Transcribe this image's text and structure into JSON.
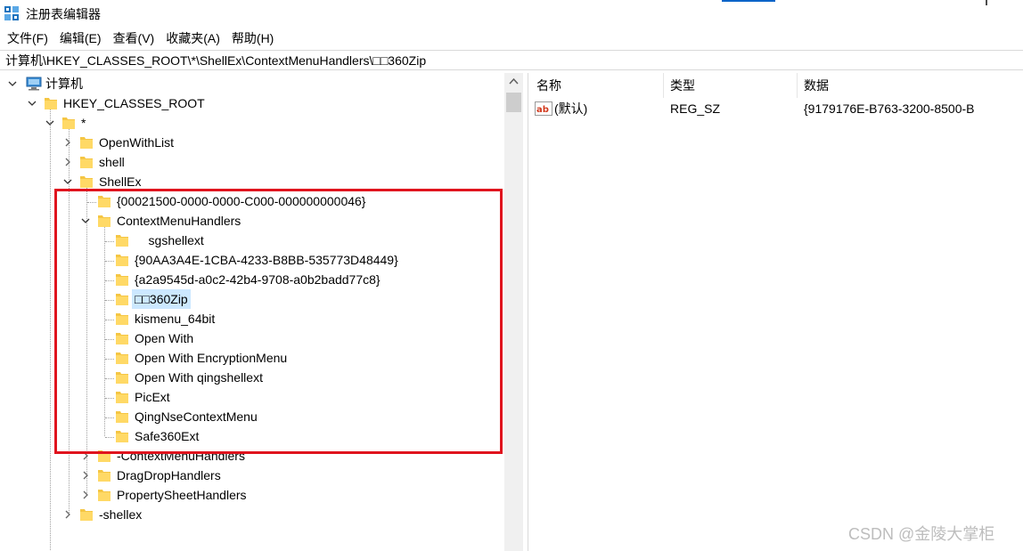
{
  "window": {
    "title": "注册表编辑器"
  },
  "menu": [
    "文件(F)",
    "编辑(E)",
    "查看(V)",
    "收藏夹(A)",
    "帮助(H)"
  ],
  "address": "计算机\\HKEY_CLASSES_ROOT\\*\\ShellEx\\ContextMenuHandlers\\□□360Zip",
  "tree": [
    {
      "label": "计算机"
    },
    {
      "label": "HKEY_CLASSES_ROOT"
    },
    {
      "label": "*"
    },
    {
      "label": "OpenWithList"
    },
    {
      "label": "shell"
    },
    {
      "label": "ShellEx"
    },
    {
      "label": "{00021500-0000-0000-C000-000000000046}"
    },
    {
      "label": "ContextMenuHandlers"
    },
    {
      "label": "    sgshellext"
    },
    {
      "label": "{90AA3A4E-1CBA-4233-B8BB-535773D48449}"
    },
    {
      "label": "{a2a9545d-a0c2-42b4-9708-a0b2badd77c8}"
    },
    {
      "label": "□□360Zip"
    },
    {
      "label": "kismenu_64bit"
    },
    {
      "label": "Open With"
    },
    {
      "label": "Open With EncryptionMenu"
    },
    {
      "label": "Open With qingshellext"
    },
    {
      "label": "PicExt"
    },
    {
      "label": "QingNseContextMenu"
    },
    {
      "label": "Safe360Ext"
    },
    {
      "label": "-ContextMenuHandlers"
    },
    {
      "label": "DragDropHandlers"
    },
    {
      "label": "PropertySheetHandlers"
    },
    {
      "label": "-shellex"
    }
  ],
  "list": {
    "columns": [
      "名称",
      "类型",
      "数据"
    ],
    "rows": [
      {
        "name": "(默认)",
        "type": "REG_SZ",
        "data": "{9179176E-B763-3200-8500-B"
      }
    ]
  },
  "watermark": "CSDN @金陵大掌柜",
  "colors": {
    "highlight": "#e0141e",
    "selection": "#cce8ff",
    "folder": "#f5c644",
    "accent": "#0a64c8"
  }
}
